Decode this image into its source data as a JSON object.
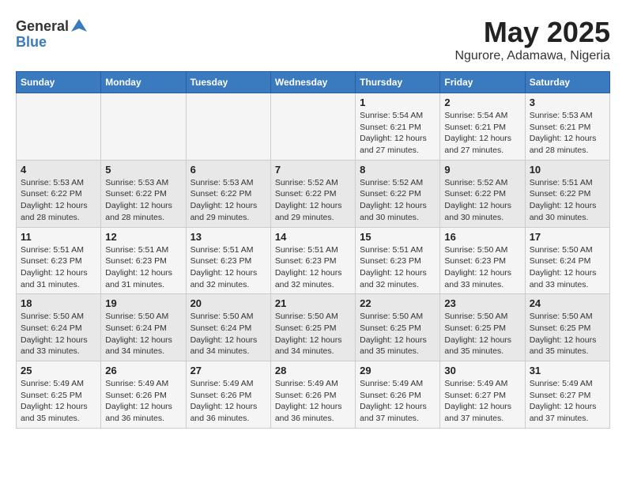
{
  "logo": {
    "text_general": "General",
    "text_blue": "Blue"
  },
  "title": "May 2025",
  "subtitle": "Ngurore, Adamawa, Nigeria",
  "days_of_week": [
    "Sunday",
    "Monday",
    "Tuesday",
    "Wednesday",
    "Thursday",
    "Friday",
    "Saturday"
  ],
  "weeks": [
    [
      {
        "day": "",
        "info": ""
      },
      {
        "day": "",
        "info": ""
      },
      {
        "day": "",
        "info": ""
      },
      {
        "day": "",
        "info": ""
      },
      {
        "day": "1",
        "info": "Sunrise: 5:54 AM\nSunset: 6:21 PM\nDaylight: 12 hours\nand 27 minutes."
      },
      {
        "day": "2",
        "info": "Sunrise: 5:54 AM\nSunset: 6:21 PM\nDaylight: 12 hours\nand 27 minutes."
      },
      {
        "day": "3",
        "info": "Sunrise: 5:53 AM\nSunset: 6:21 PM\nDaylight: 12 hours\nand 28 minutes."
      }
    ],
    [
      {
        "day": "4",
        "info": "Sunrise: 5:53 AM\nSunset: 6:22 PM\nDaylight: 12 hours\nand 28 minutes."
      },
      {
        "day": "5",
        "info": "Sunrise: 5:53 AM\nSunset: 6:22 PM\nDaylight: 12 hours\nand 28 minutes."
      },
      {
        "day": "6",
        "info": "Sunrise: 5:53 AM\nSunset: 6:22 PM\nDaylight: 12 hours\nand 29 minutes."
      },
      {
        "day": "7",
        "info": "Sunrise: 5:52 AM\nSunset: 6:22 PM\nDaylight: 12 hours\nand 29 minutes."
      },
      {
        "day": "8",
        "info": "Sunrise: 5:52 AM\nSunset: 6:22 PM\nDaylight: 12 hours\nand 30 minutes."
      },
      {
        "day": "9",
        "info": "Sunrise: 5:52 AM\nSunset: 6:22 PM\nDaylight: 12 hours\nand 30 minutes."
      },
      {
        "day": "10",
        "info": "Sunrise: 5:51 AM\nSunset: 6:22 PM\nDaylight: 12 hours\nand 30 minutes."
      }
    ],
    [
      {
        "day": "11",
        "info": "Sunrise: 5:51 AM\nSunset: 6:23 PM\nDaylight: 12 hours\nand 31 minutes."
      },
      {
        "day": "12",
        "info": "Sunrise: 5:51 AM\nSunset: 6:23 PM\nDaylight: 12 hours\nand 31 minutes."
      },
      {
        "day": "13",
        "info": "Sunrise: 5:51 AM\nSunset: 6:23 PM\nDaylight: 12 hours\nand 32 minutes."
      },
      {
        "day": "14",
        "info": "Sunrise: 5:51 AM\nSunset: 6:23 PM\nDaylight: 12 hours\nand 32 minutes."
      },
      {
        "day": "15",
        "info": "Sunrise: 5:51 AM\nSunset: 6:23 PM\nDaylight: 12 hours\nand 32 minutes."
      },
      {
        "day": "16",
        "info": "Sunrise: 5:50 AM\nSunset: 6:23 PM\nDaylight: 12 hours\nand 33 minutes."
      },
      {
        "day": "17",
        "info": "Sunrise: 5:50 AM\nSunset: 6:24 PM\nDaylight: 12 hours\nand 33 minutes."
      }
    ],
    [
      {
        "day": "18",
        "info": "Sunrise: 5:50 AM\nSunset: 6:24 PM\nDaylight: 12 hours\nand 33 minutes."
      },
      {
        "day": "19",
        "info": "Sunrise: 5:50 AM\nSunset: 6:24 PM\nDaylight: 12 hours\nand 34 minutes."
      },
      {
        "day": "20",
        "info": "Sunrise: 5:50 AM\nSunset: 6:24 PM\nDaylight: 12 hours\nand 34 minutes."
      },
      {
        "day": "21",
        "info": "Sunrise: 5:50 AM\nSunset: 6:25 PM\nDaylight: 12 hours\nand 34 minutes."
      },
      {
        "day": "22",
        "info": "Sunrise: 5:50 AM\nSunset: 6:25 PM\nDaylight: 12 hours\nand 35 minutes."
      },
      {
        "day": "23",
        "info": "Sunrise: 5:50 AM\nSunset: 6:25 PM\nDaylight: 12 hours\nand 35 minutes."
      },
      {
        "day": "24",
        "info": "Sunrise: 5:50 AM\nSunset: 6:25 PM\nDaylight: 12 hours\nand 35 minutes."
      }
    ],
    [
      {
        "day": "25",
        "info": "Sunrise: 5:49 AM\nSunset: 6:25 PM\nDaylight: 12 hours\nand 35 minutes."
      },
      {
        "day": "26",
        "info": "Sunrise: 5:49 AM\nSunset: 6:26 PM\nDaylight: 12 hours\nand 36 minutes."
      },
      {
        "day": "27",
        "info": "Sunrise: 5:49 AM\nSunset: 6:26 PM\nDaylight: 12 hours\nand 36 minutes."
      },
      {
        "day": "28",
        "info": "Sunrise: 5:49 AM\nSunset: 6:26 PM\nDaylight: 12 hours\nand 36 minutes."
      },
      {
        "day": "29",
        "info": "Sunrise: 5:49 AM\nSunset: 6:26 PM\nDaylight: 12 hours\nand 37 minutes."
      },
      {
        "day": "30",
        "info": "Sunrise: 5:49 AM\nSunset: 6:27 PM\nDaylight: 12 hours\nand 37 minutes."
      },
      {
        "day": "31",
        "info": "Sunrise: 5:49 AM\nSunset: 6:27 PM\nDaylight: 12 hours\nand 37 minutes."
      }
    ]
  ]
}
